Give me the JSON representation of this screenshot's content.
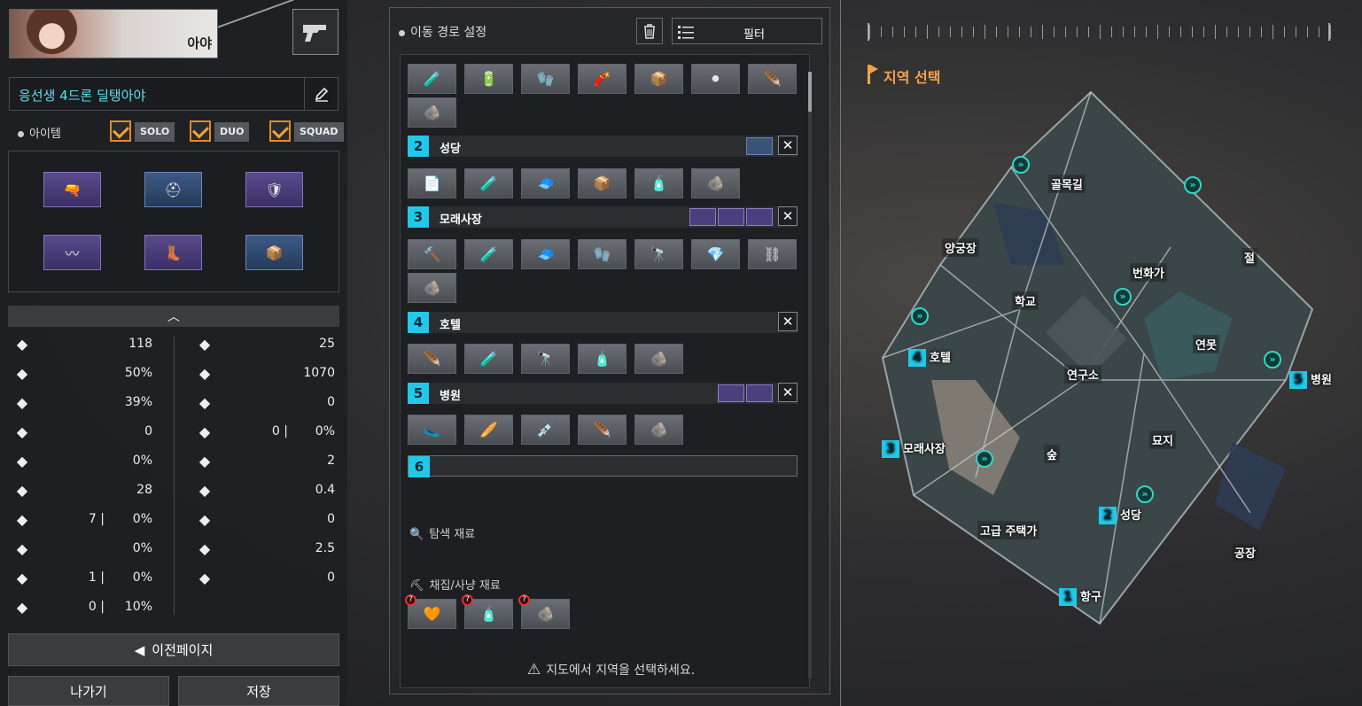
{
  "character": {
    "name": "아야",
    "route_name": "응선생 4드론 딜탱아야"
  },
  "item_section": {
    "label": "아이템",
    "modes": [
      "SOLO",
      "DUO",
      "SQUAD"
    ]
  },
  "stats_left": [
    {
      "icon": "attack-power-icon",
      "value": "118"
    },
    {
      "icon": "attack-speed-icon",
      "value": "50%"
    },
    {
      "icon": "critical-chance-icon",
      "value": "39%"
    },
    {
      "icon": "critical-damage-icon",
      "value": "0"
    },
    {
      "icon": "life-steal-icon",
      "value": "0%"
    },
    {
      "icon": "skill-amp-icon",
      "value": "28"
    },
    {
      "icon": "extra-normal-damage-icon",
      "value": "7",
      "value2": "0%"
    },
    {
      "icon": "cooldown-icon",
      "value": "0%"
    },
    {
      "icon": "armor-pen-icon",
      "value": "1",
      "value2": "0%"
    },
    {
      "icon": "omnisyphon-icon",
      "value": "0",
      "value2": "10%"
    }
  ],
  "stats_right": [
    {
      "icon": "defense-icon",
      "value": "25"
    },
    {
      "icon": "max-hp-icon",
      "value": "1070"
    },
    {
      "icon": "hp-regen-icon",
      "value": "0"
    },
    {
      "icon": "heal-icon",
      "value": "0",
      "value2": "0%"
    },
    {
      "icon": "sp-regen-icon",
      "value": "2"
    },
    {
      "icon": "normal-attack-reduction-icon",
      "value": "0.4"
    },
    {
      "icon": "skill-reduction-icon",
      "value": "0"
    },
    {
      "icon": "vision-icon",
      "value": "2.5"
    },
    {
      "icon": "move-speed-icon",
      "value": "0"
    }
  ],
  "buttons": {
    "prev_page": "이전페이지",
    "exit": "나가기",
    "save": "저장"
  },
  "route_panel": {
    "title": "이동 경로 설정",
    "filter": "필터"
  },
  "route_stops": [
    {
      "num": "2",
      "name": "성당"
    },
    {
      "num": "3",
      "name": "모래사장"
    },
    {
      "num": "4",
      "name": "호텔"
    },
    {
      "num": "5",
      "name": "병원"
    },
    {
      "num": "6",
      "name": ""
    }
  ],
  "sections": {
    "search": "탐색 재료",
    "gather": "채집/사냥 재료"
  },
  "warning": "지도에서 지역을 선택하세요.",
  "map_panel": {
    "title": "지역 선택"
  },
  "map_regions": [
    "골목길",
    "양궁장",
    "학교",
    "번화가",
    "절",
    "연못",
    "연구소",
    "묘지",
    "숲",
    "고급 주택가",
    "공장"
  ],
  "map_numbered": [
    {
      "num": "1",
      "name": "항구"
    },
    {
      "num": "2",
      "name": "성당"
    },
    {
      "num": "3",
      "name": "모래사장"
    },
    {
      "num": "4",
      "name": "호텔"
    },
    {
      "num": "5",
      "name": "병원"
    }
  ],
  "colors": {
    "accent": "#21c8ea",
    "orange": "#f7a24a",
    "rare": "#5a4a8c",
    "uncommon": "#3c5a86"
  }
}
